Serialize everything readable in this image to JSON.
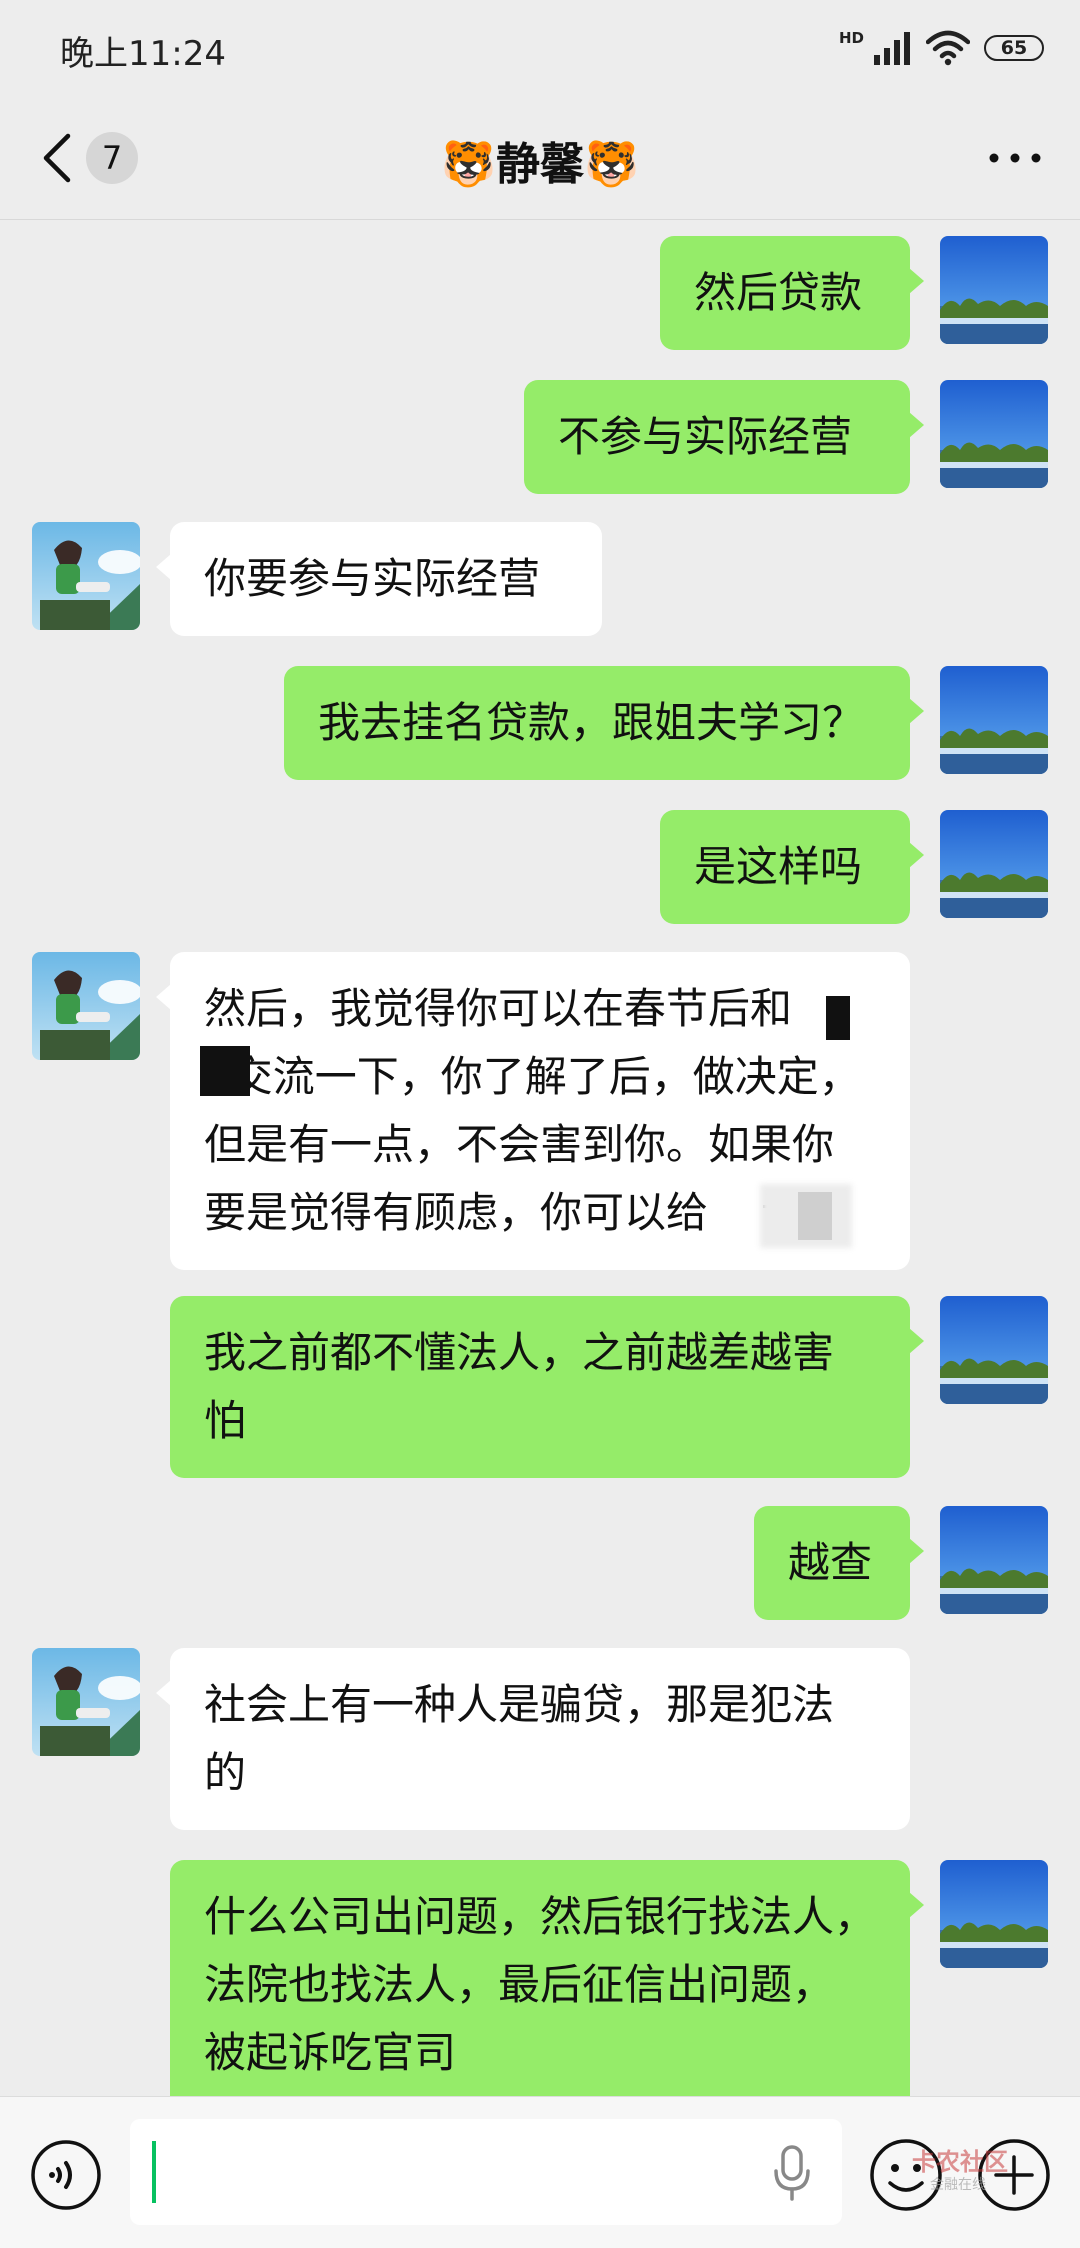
{
  "status_bar": {
    "time": "晚上11:24",
    "network": "HD",
    "battery": "65"
  },
  "nav": {
    "unread_count": "7",
    "title_emoji_left": "🐯",
    "title": "静馨",
    "title_emoji_right": "🐯"
  },
  "messages": [
    {
      "sender": "me",
      "text": "然后贷款"
    },
    {
      "sender": "me",
      "text": "不参与实际经营"
    },
    {
      "sender": "them",
      "text": "你要参与实际经营"
    },
    {
      "sender": "me",
      "text": "我去挂名贷款，跟姐夫学习？"
    },
    {
      "sender": "me",
      "text": "是这样吗"
    },
    {
      "sender": "them",
      "text": "然后，我觉得你可以在春节后和\n  交流一下，你了解了后，做决定，\n但是有一点，不会害到你。如果你\n要是觉得有顾虑，你可以给    说。"
    },
    {
      "sender": "me",
      "text": "我之前都不懂法人，之前越差越害\n怕"
    },
    {
      "sender": "me",
      "text": "越查"
    },
    {
      "sender": "them",
      "text": "社会上有一种人是骗贷，那是犯法\n的"
    },
    {
      "sender": "me",
      "text": "什么公司出问题，然后银行找法人，\n法院也找法人，最后征信出问题，\n被起诉吃官司"
    }
  ],
  "input_bar": {
    "placeholder": ""
  },
  "watermark": {
    "text": "卡农社区",
    "sub": "金融在线"
  },
  "colors": {
    "my_bubble": "#95ec69",
    "their_bubble": "#ffffff",
    "background": "#ededed",
    "accent": "#07c160"
  }
}
